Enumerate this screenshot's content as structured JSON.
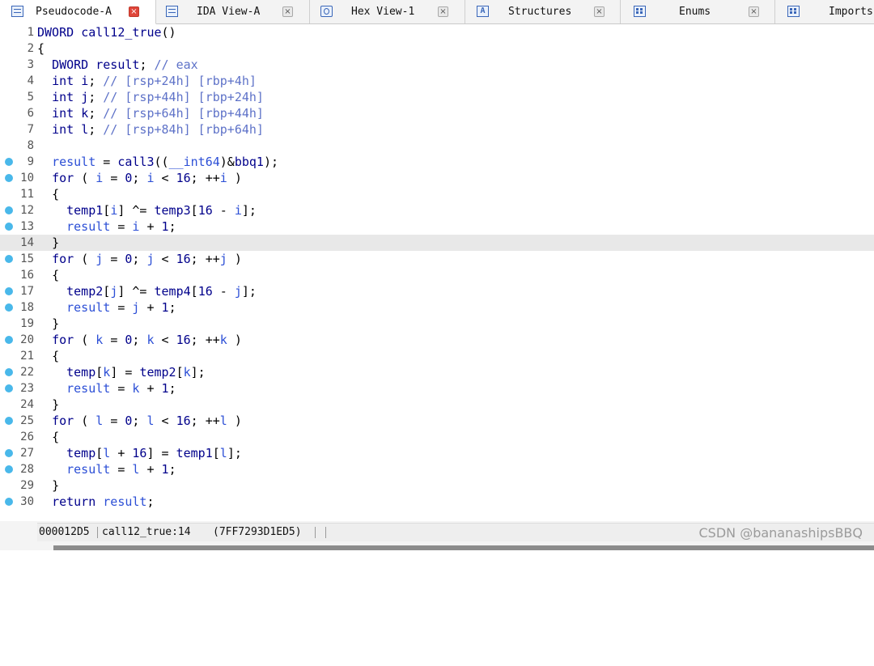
{
  "tabs": [
    {
      "label": "Pseudocode-A",
      "icon": "pseudocode-icon",
      "active": true
    },
    {
      "label": "IDA View-A",
      "icon": "ida-view-icon",
      "active": false
    },
    {
      "label": "Hex View-1",
      "icon": "hex-view-icon",
      "active": false
    },
    {
      "label": "Structures",
      "icon": "structures-icon",
      "active": false
    },
    {
      "label": "Enums",
      "icon": "enums-icon",
      "active": false
    },
    {
      "label": "Imports",
      "icon": "imports-icon",
      "active": false
    }
  ],
  "close_glyph": "×",
  "code_lines": [
    {
      "num": "1",
      "text": "DWORD call12_true()",
      "bp": false
    },
    {
      "num": "2",
      "text": "{",
      "bp": false
    },
    {
      "num": "3",
      "text": "  DWORD result; // eax",
      "bp": false
    },
    {
      "num": "4",
      "text": "  int i; // [rsp+24h] [rbp+4h]",
      "bp": false
    },
    {
      "num": "5",
      "text": "  int j; // [rsp+44h] [rbp+24h]",
      "bp": false
    },
    {
      "num": "6",
      "text": "  int k; // [rsp+64h] [rbp+44h]",
      "bp": false
    },
    {
      "num": "7",
      "text": "  int l; // [rsp+84h] [rbp+64h]",
      "bp": false
    },
    {
      "num": "8",
      "text": "",
      "bp": false
    },
    {
      "num": "9",
      "text": "  result = call3((__int64)&bbq1);",
      "bp": true
    },
    {
      "num": "10",
      "text": "  for ( i = 0; i < 16; ++i )",
      "bp": true
    },
    {
      "num": "11",
      "text": "  {",
      "bp": false
    },
    {
      "num": "12",
      "text": "    temp1[i] ^= temp3[16 - i];",
      "bp": true
    },
    {
      "num": "13",
      "text": "    result = i + 1;",
      "bp": true
    },
    {
      "num": "14",
      "text": "  }",
      "bp": false,
      "current": true
    },
    {
      "num": "15",
      "text": "  for ( j = 0; j < 16; ++j )",
      "bp": true
    },
    {
      "num": "16",
      "text": "  {",
      "bp": false
    },
    {
      "num": "17",
      "text": "    temp2[j] ^= temp4[16 - j];",
      "bp": true
    },
    {
      "num": "18",
      "text": "    result = j + 1;",
      "bp": true
    },
    {
      "num": "19",
      "text": "  }",
      "bp": false
    },
    {
      "num": "20",
      "text": "  for ( k = 0; k < 16; ++k )",
      "bp": true
    },
    {
      "num": "21",
      "text": "  {",
      "bp": false
    },
    {
      "num": "22",
      "text": "    temp[k] = temp2[k];",
      "bp": true
    },
    {
      "num": "23",
      "text": "    result = k + 1;",
      "bp": true
    },
    {
      "num": "24",
      "text": "  }",
      "bp": false
    },
    {
      "num": "25",
      "text": "  for ( l = 0; l < 16; ++l )",
      "bp": true
    },
    {
      "num": "26",
      "text": "  {",
      "bp": false
    },
    {
      "num": "27",
      "text": "    temp[l + 16] = temp1[l];",
      "bp": true
    },
    {
      "num": "28",
      "text": "    result = l + 1;",
      "bp": true
    },
    {
      "num": "29",
      "text": "  }",
      "bp": false
    },
    {
      "num": "30",
      "text": "  return result;",
      "bp": true
    }
  ],
  "status": {
    "address": "000012D5",
    "location": "call12_true:14",
    "full_address": "(7FF7293D1ED5)"
  },
  "watermark": "CSDN @bananashipsBBQ",
  "colors": {
    "keyword": "#00008b",
    "variable": "#2c4fd6",
    "comment": "#5e72c8",
    "breakpoint": "#49b8ea",
    "close_active": "#e0463a"
  }
}
